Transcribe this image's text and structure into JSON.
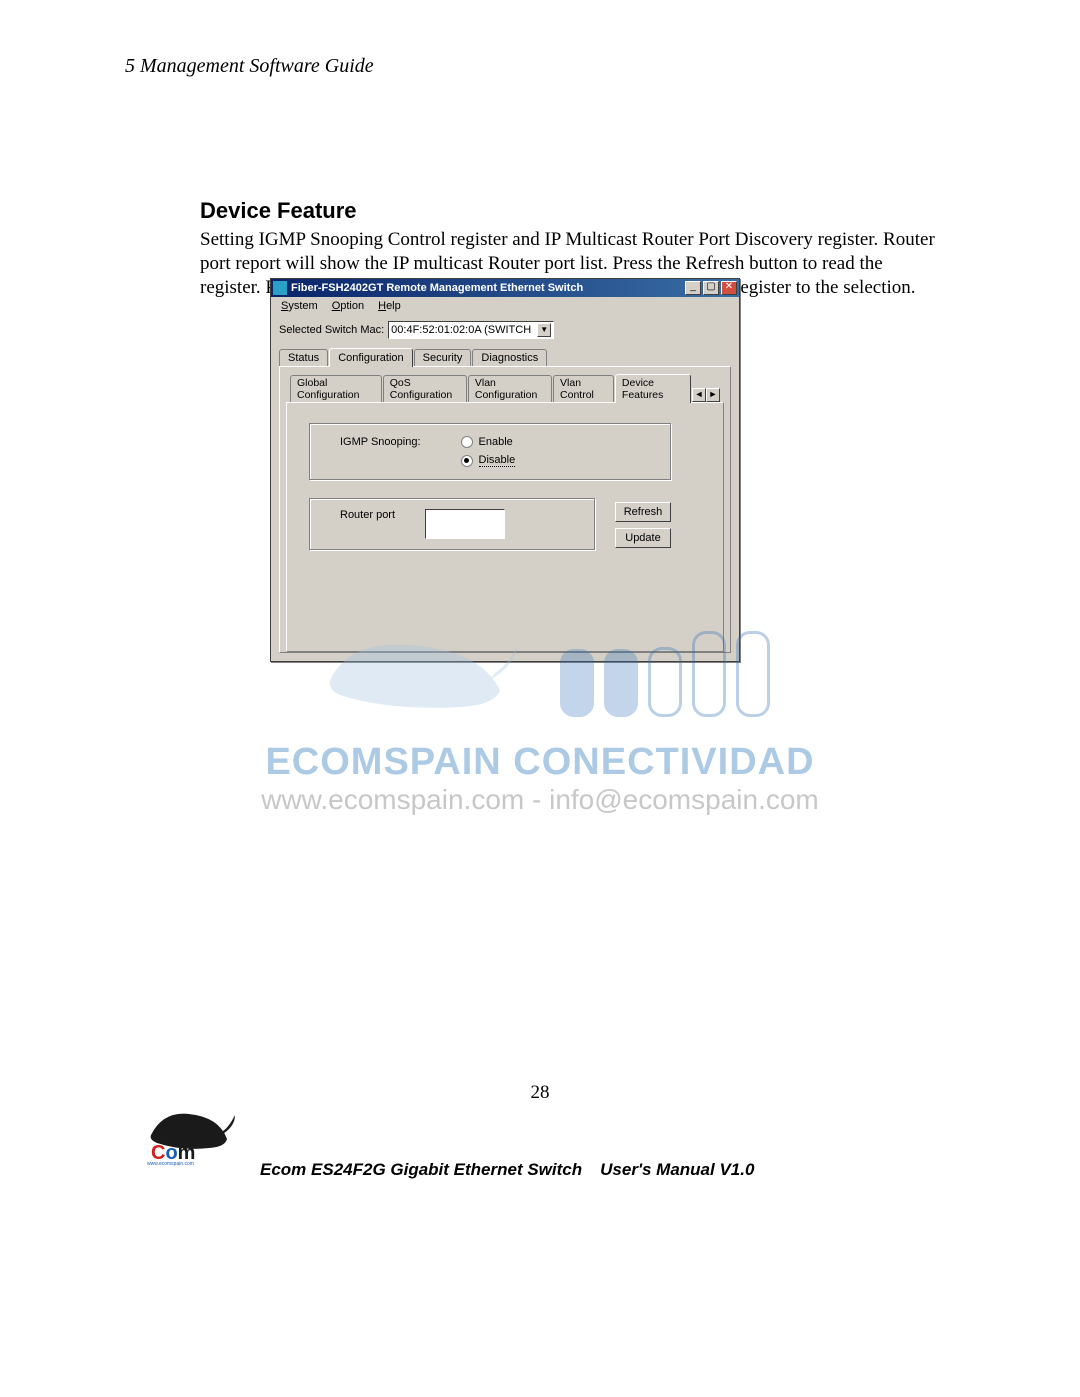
{
  "chapter_header": "5   Management Software Guide",
  "section_heading": "Device Feature",
  "body_paragraph": "Setting IGMP Snooping Control register and IP Multicast Router Port Discovery register. Router port report will show the IP multicast Router port list. Press the Refresh button to read the register. Press the Update button to set the registers, and it will set the register to the selection.",
  "app": {
    "title": "Fiber-FSH2402GT Remote Management Ethernet Switch",
    "menus": {
      "system": "System",
      "option": "Option",
      "help": "Help"
    },
    "mac_label": "Selected Switch Mac:",
    "mac_value": "00:4F:52:01:02:0A (SWITCH",
    "outer_tabs": {
      "status": "Status",
      "configuration": "Configuration",
      "security": "Security",
      "diagnostics": "Diagnostics"
    },
    "inner_tabs": {
      "global": "Global Configuration",
      "qos": "QoS Configuration",
      "vlan_cfg": "Vlan Configuration",
      "vlan_ctrl": "Vlan Control",
      "device_features": "Device Features"
    },
    "igmp": {
      "label": "IGMP Snooping:",
      "enable": "Enable",
      "disable": "Disable",
      "selected": "disable"
    },
    "router": {
      "label": "Router port"
    },
    "buttons": {
      "refresh": "Refresh",
      "update": "Update"
    }
  },
  "watermark": {
    "brand": "ECOMSPAIN CONECTIVIDAD",
    "url_line": "www.ecomspain.com - info@ecomspain.com"
  },
  "page_number": "28",
  "footer": {
    "logo_url_text": "www.ecomspain.com",
    "product": "Ecom ES24F2G Gigabit Ethernet Switch",
    "doc": "User's Manual V1.0"
  }
}
